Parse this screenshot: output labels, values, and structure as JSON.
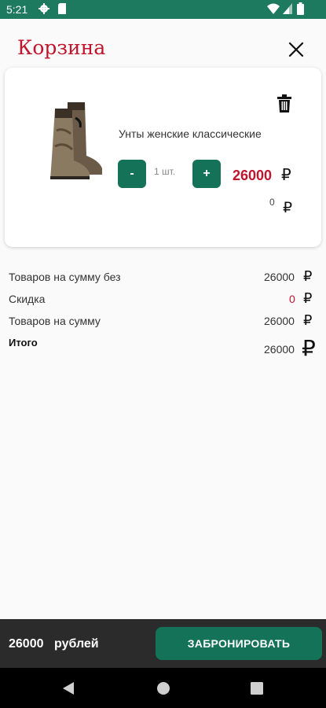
{
  "status_bar": {
    "time": "5:21"
  },
  "header": {
    "title": "Корзина"
  },
  "cart_item": {
    "name": "Унты женские классические",
    "minus_label": "-",
    "plus_label": "+",
    "quantity": "1 шт.",
    "price": "26000",
    "currency_symbol": "₽",
    "discount": "0"
  },
  "summary": [
    {
      "label": "Товаров на сумму без",
      "value": "26000",
      "currency": "₽"
    },
    {
      "label": "Скидка",
      "value": "0",
      "currency": "₽"
    },
    {
      "label": "Товаров на сумму",
      "value": "26000",
      "currency": "₽"
    },
    {
      "label": "Итого",
      "value": "26000",
      "currency": "₽"
    }
  ],
  "bottom_bar": {
    "total_amount": "26000",
    "total_unit": "рублей",
    "book_label": "ЗАБРОНИРОВАТЬ"
  },
  "icons": {
    "status": [
      "settings-icon",
      "sd-card-icon",
      "wifi-icon",
      "signal-icon",
      "battery-icon"
    ],
    "header": [
      "close-icon"
    ],
    "card": [
      "trash-icon"
    ],
    "nav": [
      "back-icon",
      "home-icon",
      "recents-icon"
    ]
  },
  "colors": {
    "status_bar": "#1d7a5f",
    "title_red": "#c0152c",
    "button_green": "#137257",
    "bottom_bar": "#2b2b2b"
  }
}
